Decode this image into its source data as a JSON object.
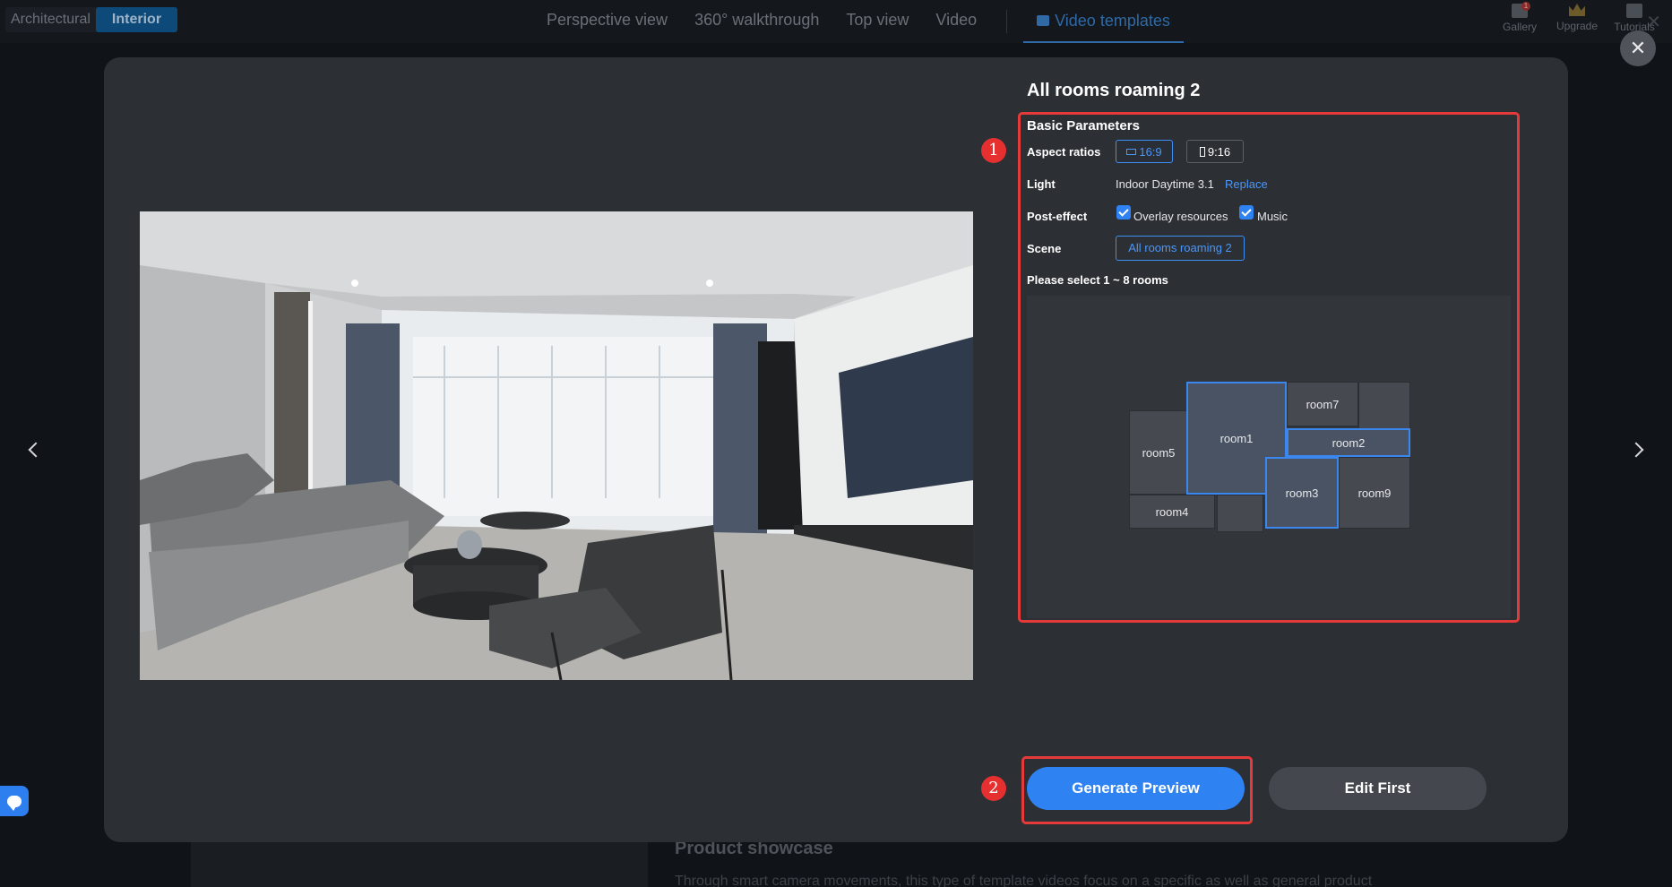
{
  "topbar": {
    "mode_architectural": "Architectural",
    "mode_interior": "Interior",
    "nav": [
      "Perspective view",
      "360° walkthrough",
      "Top view",
      "Video"
    ],
    "nav_active": "Video templates",
    "right": {
      "gallery": "Gallery",
      "gallery_badge": "1",
      "upgrade": "Upgrade",
      "tutorials": "Tutorials"
    }
  },
  "background": {
    "section_title": "Product showcase",
    "section_desc": "Through smart camera movements, this type of template videos focus on a specific as well as general product"
  },
  "modal": {
    "title": "All rooms roaming 2",
    "params": {
      "section_title": "Basic Parameters",
      "aspect_label": "Aspect ratios",
      "aspect_options": [
        "16:9",
        "9:16"
      ],
      "aspect_selected": "16:9",
      "light_label": "Light",
      "light_value": "Indoor Daytime 3.1",
      "light_action": "Replace",
      "posteffect_label": "Post-effect",
      "posteffect_overlay": "Overlay resources",
      "posteffect_music": "Music",
      "posteffect_overlay_checked": true,
      "posteffect_music_checked": true,
      "scene_label": "Scene",
      "scene_value": "All rooms roaming 2",
      "select_note": "Please select 1 ~ 8 rooms"
    },
    "rooms": [
      {
        "name": "room1",
        "selected": true
      },
      {
        "name": "room2",
        "selected": true
      },
      {
        "name": "room3",
        "selected": true
      },
      {
        "name": "room4",
        "selected": false
      },
      {
        "name": "room5",
        "selected": false
      },
      {
        "name": "room7",
        "selected": false
      },
      {
        "name": "room9",
        "selected": false
      }
    ],
    "badges": [
      "1",
      "2"
    ],
    "generate_label": "Generate Preview",
    "edit_label": "Edit First"
  },
  "colors": {
    "accent": "#2f82f2",
    "highlight_box": "#e53a3a",
    "modal_bg": "#2c2f34"
  }
}
